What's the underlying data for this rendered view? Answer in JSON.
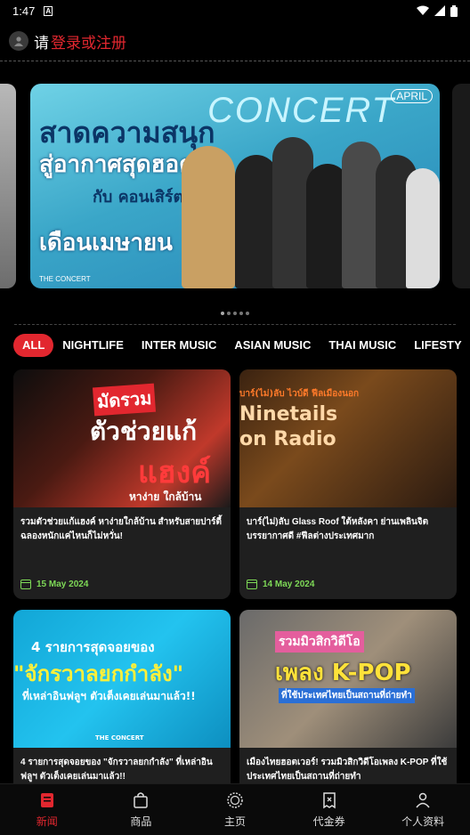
{
  "status_bar": {
    "time": "1:47",
    "notification_letter": "A"
  },
  "login_bar": {
    "prefix": "请",
    "link": "登录或注册"
  },
  "banner": {
    "line1": "สาดความสนุก",
    "line2": "สู่อากาศสุดฮอต",
    "line3": "กับ คอนเสิร์ตน่าไป",
    "line4": "เดือนเมษายน",
    "concert_word": "CONCERT",
    "month_tag": "APRIL",
    "brand": "THE CONCERT"
  },
  "tabs": [
    "ALL",
    "NIGHTLIFE",
    "INTER MUSIC",
    "ASIAN MUSIC",
    "THAI MUSIC",
    "LIFESTY"
  ],
  "articles": [
    {
      "image_text_a": "มัดรวม",
      "image_text_b": "ตัวช่วยแก้",
      "image_text_c": "แฮงค์",
      "image_text_d": "หาง่าย ใกล้บ้าน",
      "title": "รวมตัวช่วยแก้แฮงค์ หาง่ายใกล้บ้าน สำหรับสายปาร์ตี้ ฉลองหนักแค่ไหนก็ไม่หวั่น!",
      "date": "15 May 2024"
    },
    {
      "image_text_a": "บาร์(ไม่)ลับ ไวบ์ดี ฟีลเมืองนอก",
      "image_text_b": "Ninetails",
      "image_text_c": "on Radio",
      "image_text_d": "",
      "title": "บาร์(ไม่)ลับ Glass Roof ใต้หลังคา ย่านเพลินจิต บรรยากาศดี #ฟีลต่างประเทศมาก",
      "date": "14 May 2024"
    },
    {
      "image_text_a": "4 รายการสุดจอยของ",
      "image_text_b": "\"จักรวาลยกกำลัง\"",
      "image_text_c": "ที่เหล่าอินฟลูฯ ตัวเต็งเคยเล่นมาแล้ว!!",
      "image_text_d": "THE CONCERT",
      "title": "4 รายการสุดจอยของ \"จักรวาลยกกำลัง\" ที่เหล่าอินฟลูฯ ตัวเต็งเคยเล่นมาแล้ว!!",
      "date": ""
    },
    {
      "image_text_a": "รวมมิวสิกวิดีโอ",
      "image_text_b": "เพลง K-POP",
      "image_text_c": "ที่ใช้ประเทศไทยเป็นสถานที่ถ่ายทำ",
      "image_text_d": "",
      "title": "เมืองไทยฮอตเวอร์! รวมมิวสิกวิดีโอเพลง K-POP ที่ใช้ประเทศไทยเป็นสถานที่ถ่ายทำ",
      "date": ""
    }
  ],
  "bottom_nav": [
    "新闻",
    "商品",
    "主页",
    "代金券",
    "个人资料"
  ],
  "colors": {
    "accent": "#e2272f",
    "date": "#7ed957",
    "card_bg": "#1f1f1f"
  }
}
